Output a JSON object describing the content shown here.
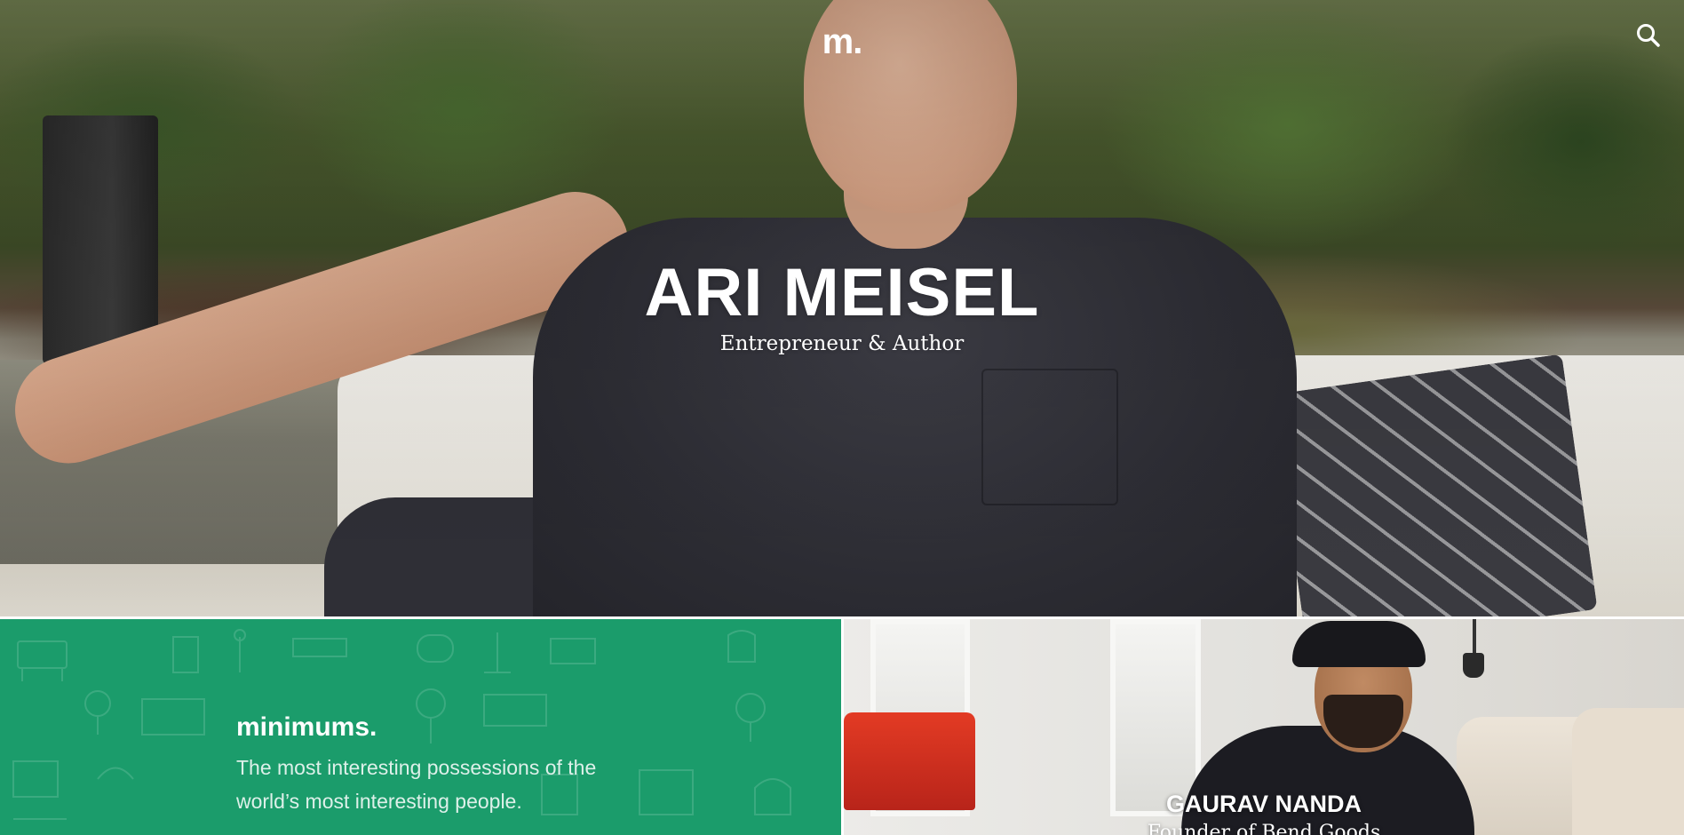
{
  "header": {
    "logo_text": "m.",
    "search_icon": "search-icon"
  },
  "hero": {
    "name": "ARI MEISEL",
    "role": "Entrepreneur & Author"
  },
  "brand_panel": {
    "name": "minimums.",
    "tagline": "The most interesting possessions of the world’s most interesting people.",
    "background_color": "#1b9c6b"
  },
  "feature_panel": {
    "name": "GAURAV NANDA",
    "role": "Founder of Bend Goods"
  }
}
